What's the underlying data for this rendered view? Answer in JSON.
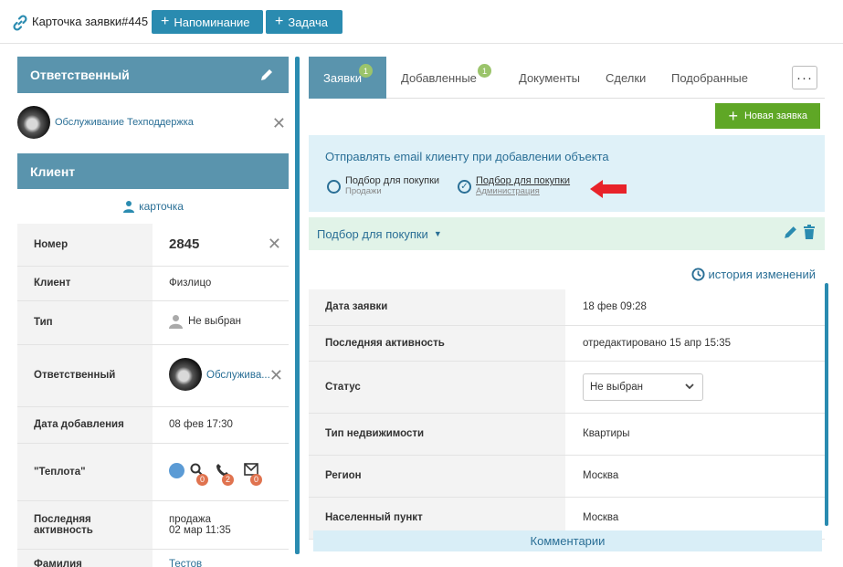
{
  "header": {
    "title": "Карточка заявки#445",
    "reminder_label": "Напоминание",
    "task_label": "Задача"
  },
  "left": {
    "responsible_head": "Ответственный",
    "responsible_name": "Обслуживание Техподдержка",
    "client_head": "Клиент",
    "card_link": "карточка",
    "rows": [
      {
        "key": "Номер",
        "value": "2845"
      },
      {
        "key": "Клиент",
        "value": "Физлицо"
      },
      {
        "key": "Тип",
        "value": "Не выбран"
      },
      {
        "key": "Ответственный",
        "value": "Обслужива..."
      },
      {
        "key": "Дата добавления",
        "value": "08 фев 17:30"
      },
      {
        "key": "\"Теплота\"",
        "counts": [
          "0",
          "2",
          "0"
        ]
      },
      {
        "key": "Последняя активность",
        "value_line1": "продажа",
        "value_line2": "02 мар 11:35"
      },
      {
        "key": "Фамилия",
        "value": "Тестов"
      }
    ]
  },
  "right": {
    "tabs": [
      {
        "label": "Заявки",
        "badge": "1"
      },
      {
        "label": "Добавленные",
        "badge": "1"
      },
      {
        "label": "Документы"
      },
      {
        "label": "Сделки"
      },
      {
        "label": "Подобранные"
      }
    ],
    "more_label": "···",
    "new_request_label": "Новая заявка",
    "email_title": "Отправлять email клиенту при добавлении объекта",
    "options": [
      {
        "main": "Подбор для покупки",
        "sub": "Продажи",
        "checked": false
      },
      {
        "main": "Подбор для покупки",
        "sub": "Администрация",
        "checked": true
      }
    ],
    "selection_title": "Подбор для покупки",
    "history_label": "история изменений",
    "rows": [
      {
        "key": "Дата заявки",
        "value": "18 фев 09:28"
      },
      {
        "key": "Последняя активность",
        "value": "отредактировано 15 апр 15:35"
      },
      {
        "key": "Статус",
        "value": "Не выбран"
      },
      {
        "key": "Тип недвижимости",
        "value": "Квартиры"
      },
      {
        "key": "Регион",
        "value": "Москва"
      },
      {
        "key": "Населенный пункт",
        "value": "Москва"
      }
    ],
    "comments_label": "Комментарии"
  },
  "colors": {
    "accent": "#2a8bb0",
    "section_head": "#5a94ad",
    "green": "#5fa726",
    "badge_green": "#9bc46b",
    "counter_orange": "#e0734f",
    "arrow_red": "#e8232a"
  }
}
